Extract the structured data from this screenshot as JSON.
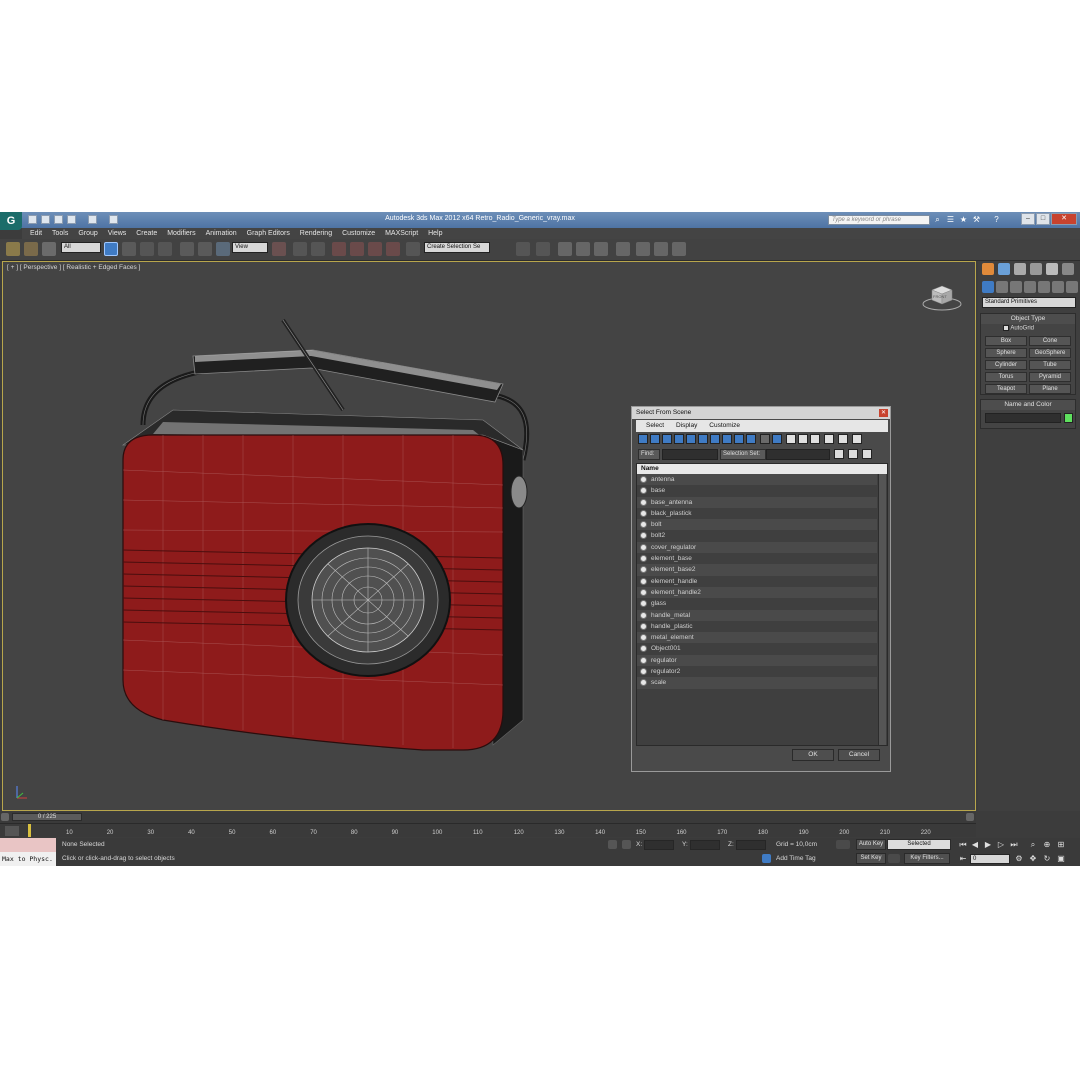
{
  "window": {
    "title": "Autodesk 3ds Max  2012 x64    Retro_Radio_Generic_vray.max",
    "search_placeholder": "Type a keyword or phrase"
  },
  "menu": [
    "Edit",
    "Tools",
    "Group",
    "Views",
    "Create",
    "Modifiers",
    "Animation",
    "Graph Editors",
    "Rendering",
    "Customize",
    "MAXScript",
    "Help"
  ],
  "toolbar": {
    "filter_value": "All",
    "refcoord_value": "View",
    "selection_set_value": "Create Selection Se"
  },
  "viewport": {
    "label": "[ + ] [ Perspective ] [ Realistic + Edged Faces ]",
    "viewcube_label": "FRONT"
  },
  "dialog": {
    "title": "Select From Scene",
    "menu": [
      "Select",
      "Display",
      "Customize"
    ],
    "find_label": "Find:",
    "selection_set_label": "Selection Set:",
    "column_name": "Name",
    "objects": [
      "antenna",
      "base",
      "base_antenna",
      "black_plastick",
      "bolt",
      "bolt2",
      "cover_regulator",
      "element_base",
      "element_base2",
      "element_handle",
      "element_handle2",
      "glass",
      "handle_metal",
      "handle_plastic",
      "metal_element",
      "Object001",
      "regulator",
      "regulator2",
      "scale"
    ],
    "ok_label": "OK",
    "cancel_label": "Cancel"
  },
  "command_panel": {
    "category_value": "Standard Primitives",
    "object_type_title": "Object Type",
    "autogrid_label": "AutoGrid",
    "buttons": [
      "Box",
      "Cone",
      "Sphere",
      "GeoSphere",
      "Cylinder",
      "Tube",
      "Torus",
      "Pyramid",
      "Teapot",
      "Plane"
    ],
    "name_color_title": "Name and Color",
    "color_swatch": "#5ee05e"
  },
  "timeline": {
    "frame_counter": "0 / 225",
    "ticks": [
      "10",
      "20",
      "30",
      "40",
      "50",
      "60",
      "70",
      "80",
      "90",
      "100",
      "110",
      "120",
      "130",
      "140",
      "150",
      "160",
      "170",
      "180",
      "190",
      "200",
      "210",
      "220"
    ]
  },
  "status": {
    "maxscript_text": "Max to Physc.",
    "selection_text": "None Selected",
    "prompt_text": "Click or click-and-drag to select objects",
    "x_label": "X:",
    "y_label": "Y:",
    "z_label": "Z:",
    "grid_text": "Grid = 10,0cm",
    "add_time_tag": "Add Time Tag",
    "auto_key": "Auto Key",
    "auto_key_mode": "Selected",
    "set_key": "Set Key",
    "key_filters": "Key Filters...",
    "current_frame": "0"
  },
  "colors": {
    "radio_body": "#8e1b1b",
    "viewport_bg": "#444444",
    "active_border": "#b8a64c"
  }
}
